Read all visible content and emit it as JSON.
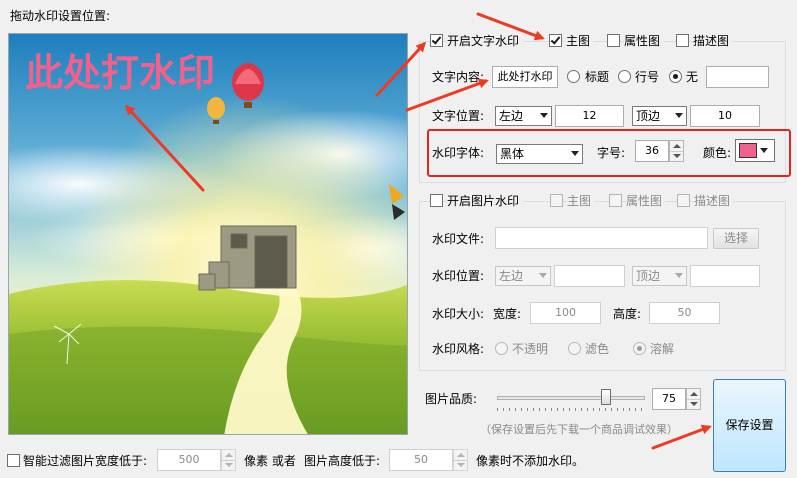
{
  "header": {
    "title": "拖动水印设置位置:"
  },
  "preview": {
    "watermark_text": "此处打水印"
  },
  "text_watermark": {
    "enable_label": "开启文字水印",
    "targets": [
      {
        "label": "主图",
        "checked": true
      },
      {
        "label": "属性图",
        "checked": false
      },
      {
        "label": "描述图",
        "checked": false
      }
    ],
    "content_label": "文字内容:",
    "content_value": "此处打水印",
    "content_options": [
      {
        "label": "标题",
        "selected": false
      },
      {
        "label": "行号",
        "selected": false
      },
      {
        "label": "无",
        "selected": true
      }
    ],
    "position_label": "文字位置:",
    "horizontal": "左边",
    "x_value": "12",
    "vertical": "顶边",
    "y_value": "10",
    "font_label": "水印字体:",
    "font_value": "黑体",
    "size_label": "字号:",
    "size_value": "36",
    "color_label": "颜色:",
    "color_value": "#f0628c"
  },
  "image_watermark": {
    "enable_label": "开启图片水印",
    "targets": [
      {
        "label": "主图"
      },
      {
        "label": "属性图"
      },
      {
        "label": "描述图"
      }
    ],
    "file_label": "水印文件:",
    "browse_label": "选择",
    "position_label": "水印位置:",
    "horizontal": "左边",
    "vertical": "顶边",
    "size_label": "水印大小:",
    "width_label": "宽度:",
    "width_value": "100",
    "height_label": "高度:",
    "height_value": "50",
    "style_label": "水印风格:",
    "styles": [
      {
        "label": "不透明",
        "selected": false
      },
      {
        "label": "滤色",
        "selected": false
      },
      {
        "label": "溶解",
        "selected": true
      }
    ]
  },
  "quality": {
    "label": "图片品质:",
    "value": "75",
    "level": 0.75,
    "hint": "（保存设置后先下载一个商品调试效果）"
  },
  "save_button": {
    "label": "保存设置"
  },
  "filter": {
    "label": "智能过滤图片宽度低于:",
    "width_value": "500",
    "pixel_or_label": "像素 或者",
    "height_label": "图片高度低于:",
    "height_value": "50",
    "suffix_label": "像素时不添加水印。"
  },
  "colors": {
    "highlight": "#e02424",
    "arrow": "#ee3a22",
    "accent": "#0a67c2"
  }
}
